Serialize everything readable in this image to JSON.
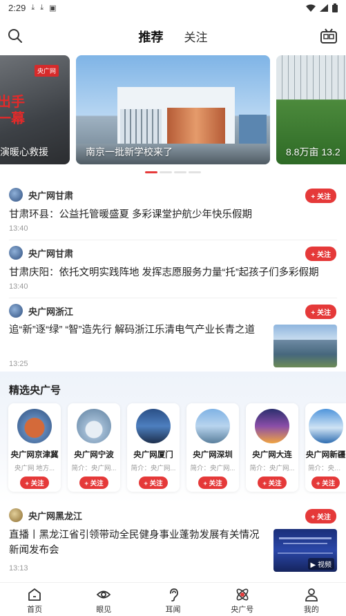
{
  "status": {
    "time": "2:29"
  },
  "header": {
    "tabs": [
      {
        "label": "推荐"
      },
      {
        "label": "关注"
      }
    ]
  },
  "carousel": {
    "slides": [
      {
        "caption": "演暖心救援",
        "overlay": "出手\n一幕",
        "badge": "央广网"
      },
      {
        "caption": "南京一批新学校来了"
      },
      {
        "caption": "8.8万亩 13.2"
      }
    ]
  },
  "feed": [
    {
      "author": "央广网甘肃",
      "follow": "+ 关注",
      "title": "甘肃环县：公益托管暖盛夏 多彩课堂护航少年快乐假期",
      "time": "13:40"
    },
    {
      "author": "央广网甘肃",
      "follow": "+ 关注",
      "title": "甘肃庆阳：依托文明实践阵地 发挥志愿服务力量“托”起孩子们多彩假期",
      "time": "13:40"
    },
    {
      "author": "央广网浙江",
      "follow": "+ 关注",
      "title": "追“新”逐“绿” “智”造先行 解码浙江乐清电气产业长青之道",
      "time": "13:25"
    },
    {
      "author": "央广网黑龙江",
      "follow": "+ 关注",
      "title": "直播丨黑龙江省引领带动全民健身事业蓬勃发展有关情况新闻发布会",
      "time": "13:13",
      "thumb_label": "视频"
    }
  ],
  "picks": {
    "title": "精选央广号",
    "cards": [
      {
        "name": "央广网京津冀",
        "desc": "央广网 地方...",
        "follow": "+ 关注"
      },
      {
        "name": "央广网宁波",
        "desc": "简介：央广网...",
        "follow": "+ 关注"
      },
      {
        "name": "央广网厦门",
        "desc": "简介：央广网...",
        "follow": "+ 关注"
      },
      {
        "name": "央广网深圳",
        "desc": "简介：央广网...",
        "follow": "+ 关注"
      },
      {
        "name": "央广网大连",
        "desc": "简介：央广网...",
        "follow": "+ 关注"
      },
      {
        "name": "央广网新疆",
        "desc": "简介：央广网...",
        "follow": "+ 关注"
      }
    ]
  },
  "nav": [
    {
      "label": "首页"
    },
    {
      "label": "眼见"
    },
    {
      "label": "耳闻"
    },
    {
      "label": "央广号"
    },
    {
      "label": "我的"
    }
  ]
}
